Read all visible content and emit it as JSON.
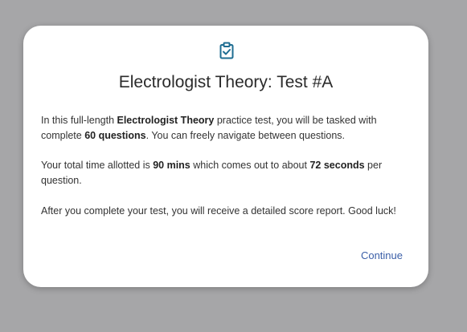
{
  "modal": {
    "icon": "clipboard-check-icon",
    "icon_color": "#1e6d92",
    "title": "Electrologist Theory: Test #A",
    "paragraph1": {
      "t1": "In this full-length ",
      "b1": "Electrologist Theory",
      "t2": " practice test, you will be tasked with complete ",
      "b2": "60 questions",
      "t3": ". You can freely navigate between questions."
    },
    "paragraph2": {
      "t1": "Your total time allotted is ",
      "b1": "90 mins",
      "t2": " which comes out to about ",
      "b2": "72 seconds",
      "t3": " per question."
    },
    "paragraph3": "After you complete your test, you will receive a detailed score report. Good luck!",
    "continue_label": "Continue",
    "link_color": "#3b5fa8"
  }
}
